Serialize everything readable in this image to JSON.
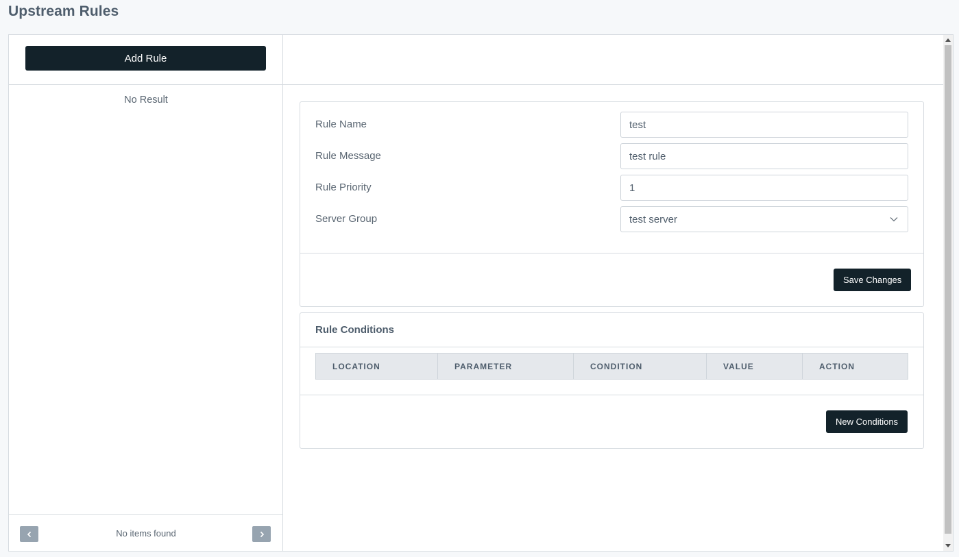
{
  "page": {
    "title": "Upstream Rules"
  },
  "sidebar": {
    "add_rule_label": "Add Rule",
    "empty_text": "No Result",
    "pagination": {
      "status_text": "No items found",
      "prev_icon": "chevron-left-icon",
      "next_icon": "chevron-right-icon"
    }
  },
  "rule_form": {
    "name_label": "Rule Name",
    "name_value": "test",
    "message_label": "Rule Message",
    "message_value": "test rule",
    "priority_label": "Rule Priority",
    "priority_value": "1",
    "server_group_label": "Server Group",
    "server_group_value": "test server",
    "save_label": "Save Changes"
  },
  "conditions": {
    "title": "Rule Conditions",
    "columns": [
      "LOCATION",
      "PARAMETER",
      "CONDITION",
      "VALUE",
      "ACTION"
    ],
    "new_label": "New Conditions"
  },
  "colors": {
    "primary_button": "#13222a",
    "pager_button": "#97a4b0",
    "table_header": "#e5e8ec"
  }
}
